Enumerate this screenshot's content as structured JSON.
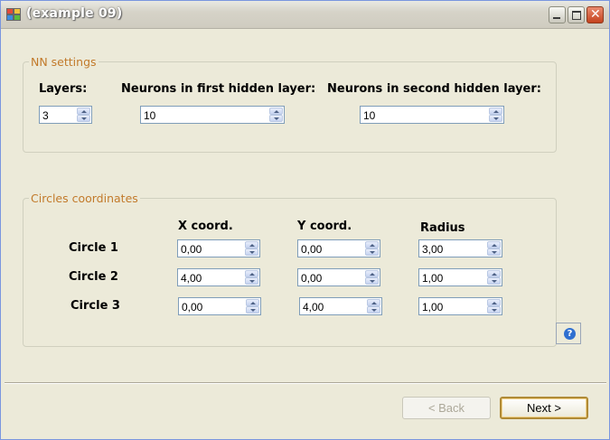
{
  "window": {
    "title": "(example 09)"
  },
  "nn_settings": {
    "group_title": "NN settings",
    "layers_label": "Layers:",
    "layers_value": "3",
    "first_label": "Neurons in first hidden layer:",
    "first_value": "10",
    "second_label": "Neurons in second hidden layer:",
    "second_value": "10"
  },
  "circles": {
    "group_title": "Circles coordinates",
    "headers": {
      "x": "X coord.",
      "y": "Y coord.",
      "r": "Radius"
    },
    "rows": [
      {
        "label": "Circle 1",
        "x": "0,00",
        "y": "0,00",
        "r": "3,00"
      },
      {
        "label": "Circle 2",
        "x": "4,00",
        "y": "0,00",
        "r": "1,00"
      },
      {
        "label": "Circle 3",
        "x": "0,00",
        "y": "4,00",
        "r": "1,00"
      }
    ]
  },
  "help": {
    "icon": "?"
  },
  "buttons": {
    "back": "< Back",
    "next": "Next >"
  },
  "icons": [
    "app-icon",
    "minimize-icon",
    "maximize-icon",
    "close-icon",
    "help-icon"
  ]
}
